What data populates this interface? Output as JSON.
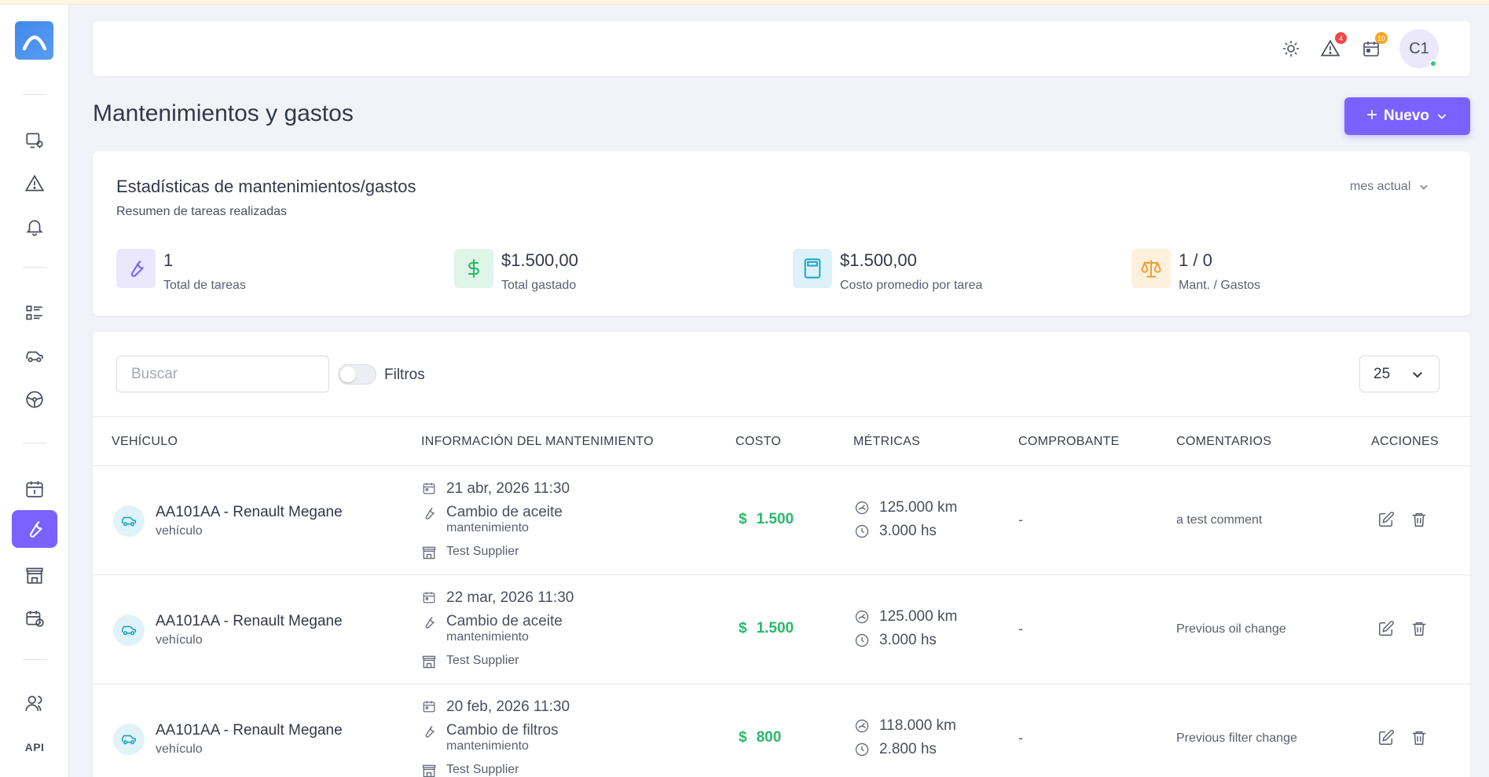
{
  "header": {
    "alerts_badge": "4",
    "calendar_badge": "10",
    "avatar_initials": "C1"
  },
  "sidebar": {
    "api_label": "API"
  },
  "page": {
    "title": "Mantenimientos y gastos",
    "new_button": "Nuevo"
  },
  "stats": {
    "title": "Estadísticas de mantenimientos/gastos",
    "subtitle": "Resumen de tareas realizadas",
    "period": "mes actual",
    "items": [
      {
        "value": "1",
        "label": "Total de tareas",
        "icon": "wrench-icon",
        "color": "#7b61ff"
      },
      {
        "value": "$1.500,00",
        "label": "Total gastado",
        "icon": "dollar-icon",
        "color": "#28b96a"
      },
      {
        "value": "$1.500,00",
        "label": "Costo promedio por tarea",
        "icon": "calculator-icon",
        "color": "#1aa3c4"
      },
      {
        "value": "1 / 0",
        "label": "Mant. / Gastos",
        "icon": "scale-icon",
        "color": "#f0a030"
      }
    ]
  },
  "table": {
    "search_placeholder": "Buscar",
    "filters_label": "Filtros",
    "page_size": "25",
    "columns": [
      "VEHÍCULO",
      "INFORMACIÓN DEL MANTENIMIENTO",
      "COSTO",
      "MÉTRICAS",
      "COMPROBANTE",
      "COMENTARIOS",
      "ACCIONES"
    ],
    "rows": [
      {
        "vehicle": "AA101AA - Renault Megane",
        "vehicle_type": "vehículo",
        "date": "21 abr, 2026 11:30",
        "task": "Cambio de aceite",
        "category": "mantenimiento",
        "supplier": "Test Supplier",
        "cost_symbol": "$",
        "cost": "1.500",
        "km": "125.000 km",
        "hours": "3.000 hs",
        "receipt": "-",
        "comment": "a test comment"
      },
      {
        "vehicle": "AA101AA - Renault Megane",
        "vehicle_type": "vehículo",
        "date": "22 mar, 2026 11:30",
        "task": "Cambio de aceite",
        "category": "mantenimiento",
        "supplier": "Test Supplier",
        "cost_symbol": "$",
        "cost": "1.500",
        "km": "125.000 km",
        "hours": "3.000 hs",
        "receipt": "-",
        "comment": "Previous oil change"
      },
      {
        "vehicle": "AA101AA - Renault Megane",
        "vehicle_type": "vehículo",
        "date": "20 feb, 2026 11:30",
        "task": "Cambio de filtros",
        "category": "mantenimiento",
        "supplier": "Test Supplier",
        "cost_symbol": "$",
        "cost": "800",
        "km": "118.000 km",
        "hours": "2.800 hs",
        "receipt": "-",
        "comment": "Previous filter change"
      }
    ]
  }
}
